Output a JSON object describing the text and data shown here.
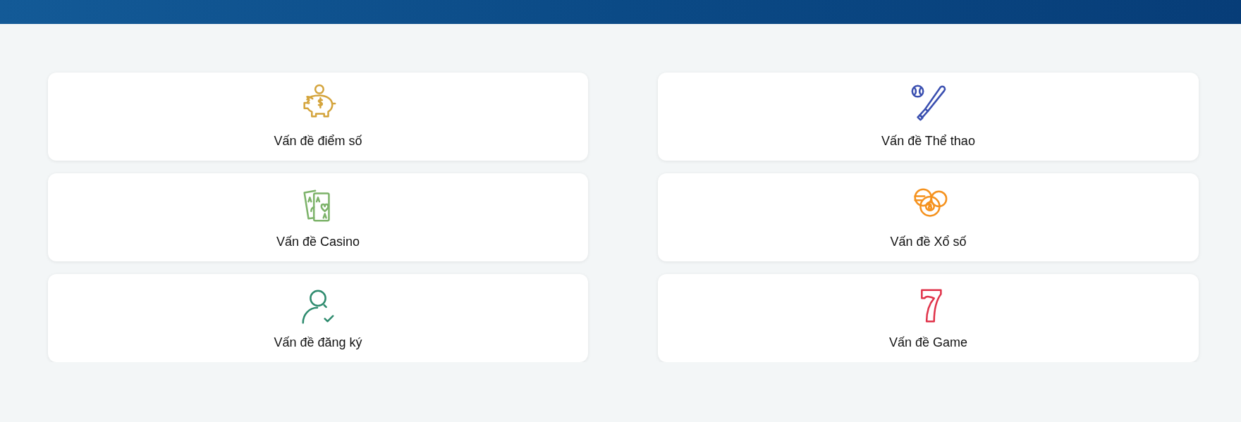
{
  "categories": [
    {
      "label": "Vấn đề điểm số"
    },
    {
      "label": "Vấn đề Thể thao"
    },
    {
      "label": "Vấn đề Casino"
    },
    {
      "label": "Vấn đề Xổ số"
    },
    {
      "label": "Vấn đề đăng ký"
    },
    {
      "label": "Vấn đề Game"
    }
  ]
}
